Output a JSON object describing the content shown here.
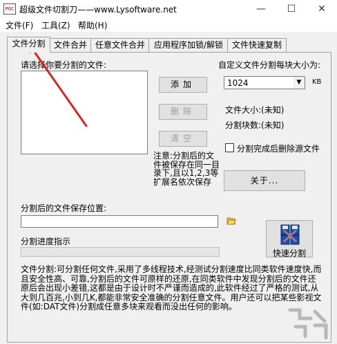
{
  "window": {
    "title": "超级文件切割刀——www.Lysoftware.net",
    "icon_text": "POC",
    "minimize": "—",
    "maximize": "☐",
    "close": "✕"
  },
  "menu": [
    "文件(F)",
    "工具(Z)",
    "帮助(H)"
  ],
  "tabs": [
    "文件分割",
    "文件合并",
    "任意文件合并",
    "应用程序加锁/解锁",
    "文件快速复制"
  ],
  "split": {
    "select_label": "请选择你要分割的文件:",
    "custom_size_label": "自定义文件分割每块大小为:",
    "size_value": "1024",
    "size_unit": "KB",
    "add_button": "添加",
    "delete_button": "删除",
    "clear_button": "清空",
    "file_size_label": "文件大小:(未知)",
    "block_count_label": "分割块数:(未知)",
    "delete_source_label": "分割完成后删除源文件",
    "note": "注意:分割后的文件被保存在同一目录下,且以1,2,3等扩展名依次保存",
    "about_button": "关于...",
    "save_path_label": "分割后的文件保存位置:",
    "save_path_value": "",
    "progress_label": "分割进度指示",
    "progress_value": 0,
    "quick_split_button": "快速分割",
    "description": "文件分割:可分割任何文件,采用了多线程技术,经测试分割速度比同类软件速度快,而且安全性高、可靠,分割后的文件可原样的还原,在同类软件中发现分割后的文件还原后会出现小差错,这都是由于设计时不严谨而造成的,此软件经过了严格的测试,从大到几百兆,小到几K,都能非常安全准确的分割任意文件。用户还可以把某些影视文件(如:DAT文件)分割成任意多块来观看而没出任何的影响。"
  },
  "colors": {
    "annotation_arrow": "#d9261c",
    "progress_fill": "#06b025"
  }
}
